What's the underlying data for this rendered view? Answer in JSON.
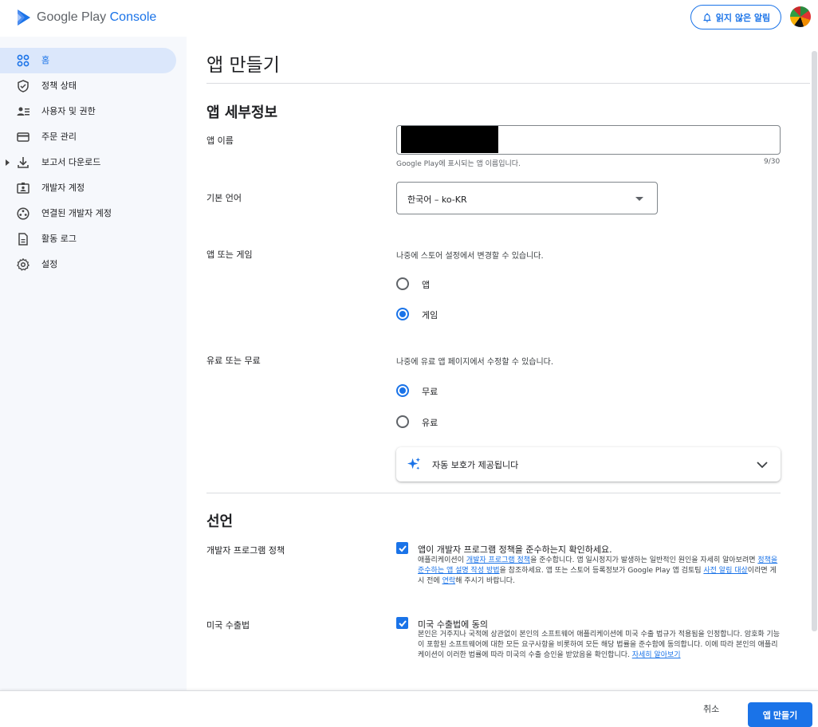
{
  "header": {
    "logo_text_main": "Google Play",
    "logo_text_accent": "Console",
    "notifications_label": "읽지 않은 알림"
  },
  "sidebar": {
    "items": [
      {
        "label": "홈",
        "icon": "grid-icon",
        "active": true
      },
      {
        "label": "정책 상태",
        "icon": "shield-icon"
      },
      {
        "label": "사용자 및 권한",
        "icon": "users-icon"
      },
      {
        "label": "주문 관리",
        "icon": "credit-card-icon"
      },
      {
        "label": "보고서 다운로드",
        "icon": "download-icon"
      },
      {
        "label": "개발자 계정",
        "icon": "id-card-icon"
      },
      {
        "label": "연결된 개발자 계정",
        "icon": "linked-accounts-icon"
      },
      {
        "label": "활동 로그",
        "icon": "document-icon"
      },
      {
        "label": "설정",
        "icon": "gear-icon"
      }
    ]
  },
  "main": {
    "page_title": "앱 만들기",
    "details_section_title": "앱 세부정보",
    "app_name": {
      "label": "앱 이름",
      "helper": "Google Play에 표시되는 앱 이름입니다.",
      "counter": "9/30"
    },
    "default_language": {
      "label": "기본 언어",
      "value": "한국어 – ko-KR"
    },
    "app_or_game": {
      "label": "앱 또는 게임",
      "description": "나중에 스토어 설정에서 변경할 수 있습니다.",
      "options": [
        {
          "label": "앱",
          "checked": false
        },
        {
          "label": "게임",
          "checked": true
        }
      ]
    },
    "free_or_paid": {
      "label": "유료 또는 무료",
      "description": "나중에 유료 앱 페이지에서 수정할 수 있습니다.",
      "options": [
        {
          "label": "무료",
          "checked": true
        },
        {
          "label": "유료",
          "checked": false
        }
      ]
    },
    "auto_protection": {
      "label": "자동 보호가 제공됩니다"
    },
    "declarations_title": "선언",
    "developer_policy": {
      "label": "개발자 프로그램 정책",
      "checkbox_title": "앱이 개발자 프로그램 정책을 준수하는지 확인하세요.",
      "body_1": "애플리케이션이 ",
      "link_1": "개발자 프로그램 정책",
      "body_2": "을 준수합니다. 앱 일시정지가 발생하는 일반적인 원인을 자세히 알아보려면 ",
      "link_2": "정책을 준수하는 앱 설명 작성 방법",
      "body_3": "을 참조하세요. 앱 또는 스토어 등록정보가 Google Play 앱 검토팀 ",
      "link_3": "사전 알림 대상",
      "body_4": "이라면 게시 전에 ",
      "link_4": "연락",
      "body_5": "해 주시기 바랍니다."
    },
    "export_law": {
      "label": "미국 수출법",
      "checkbox_title": "미국 수출법에 동의",
      "body_1": "본인은 거주지나 국적에 상관없이 본인의 소프트웨어 애플리케이션에 미국 수출 법규가 적용됨을 인정합니다. 암호화 기능이 포함된 소프트웨어에 대한 모든 요구사항을 비롯하여 모든 해당 법률을 준수함에 동의합니다. 이에 따라 본인의 애플리케이션이 이러한 법률에 따라 미국의 수출 승인을 받았음을 확인합니다. ",
      "link_1": "자세히 알아보기"
    }
  },
  "footer": {
    "cancel_label": "취소",
    "create_label": "앱 만들기"
  },
  "colors": {
    "accent": "#1a73e8",
    "sidebar_bg": "#f6f8fc",
    "active_bg": "#dbe7fb"
  }
}
